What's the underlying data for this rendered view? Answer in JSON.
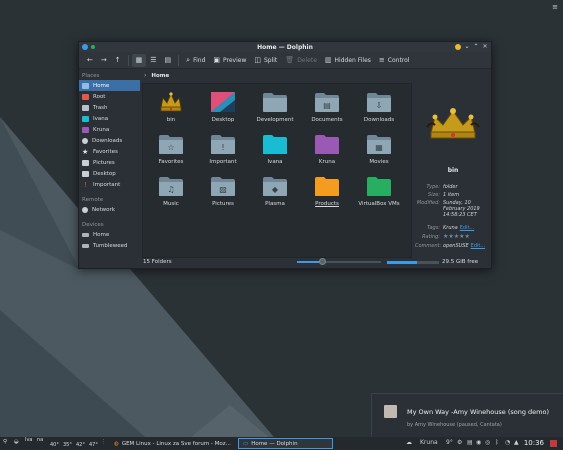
{
  "window": {
    "title": "Home — Dolphin"
  },
  "toolbar": {
    "find": "Find",
    "preview": "Preview",
    "split": "Split",
    "delete": "Delete",
    "hidden_files": "Hidden Files",
    "control": "Control"
  },
  "breadcrumb": "Home",
  "sidebar": {
    "places_heading": "Places",
    "places": [
      "Home",
      "Root",
      "Trash",
      "Ivana",
      "Kruna",
      "Downloads",
      "Favorites",
      "Pictures",
      "Desktop",
      "Important"
    ],
    "remote_heading": "Remote",
    "remote": [
      "Network"
    ],
    "devices_heading": "Devices",
    "devices": [
      "Home",
      "Tumbleweed"
    ]
  },
  "files": [
    {
      "name": "bin",
      "icon": "crown-icon"
    },
    {
      "name": "Desktop",
      "icon": "desktop-folder-icon"
    },
    {
      "name": "Development",
      "icon": "folder-icon"
    },
    {
      "name": "Documents",
      "icon": "documents-folder-icon"
    },
    {
      "name": "Downloads",
      "icon": "downloads-folder-icon"
    },
    {
      "name": "Favorites",
      "icon": "star-folder-icon"
    },
    {
      "name": "Important",
      "icon": "important-folder-icon"
    },
    {
      "name": "Ivana",
      "icon": "cyan-folder-icon"
    },
    {
      "name": "Kruna",
      "icon": "purple-folder-icon"
    },
    {
      "name": "Movies",
      "icon": "movies-folder-icon"
    },
    {
      "name": "Music",
      "icon": "music-folder-icon"
    },
    {
      "name": "Pictures",
      "icon": "pictures-folder-icon"
    },
    {
      "name": "Plasma",
      "icon": "plasma-folder-icon"
    },
    {
      "name": "Products",
      "icon": "orange-folder-icon"
    },
    {
      "name": "VirtualBox VMs",
      "icon": "green-folder-icon"
    }
  ],
  "info": {
    "name": "bin",
    "type_label": "Type:",
    "type": "folder",
    "size_label": "Size:",
    "size": "1 item",
    "modified_label": "Modified:",
    "modified": [
      "Sunday, 10",
      "February 2019",
      "14:58:23 CET"
    ],
    "tags_label": "Tags:",
    "tags": "Kruna",
    "tags_edit": "Edit...",
    "rating_label": "Rating:",
    "rating": 5,
    "rating_stars": "★★★★★",
    "comment_label": "Comment:",
    "comment": "openSUSE",
    "comment_edit": "Edit..."
  },
  "status": {
    "count": "15 Folders",
    "free": "29.5 GiB free",
    "zoom": 0.3,
    "used": 0.58
  },
  "notification": {
    "title": "My Own Way -Amy Winehouse (song demo)",
    "subtitle": "by Amy Winehouse (paused, Cantata)"
  },
  "taskbar": {
    "lang_a": "Iva",
    "lang_b": "na",
    "temps": [
      "40°",
      "35°",
      "42°",
      "47°"
    ],
    "tasks": [
      "GEM Linux - Linux za Sve forum - Moz...",
      "Home — Dolphin"
    ],
    "tray_name": "Kruna",
    "weather": "9°",
    "clock": "10:36"
  },
  "colors": {
    "accent": "#3d9ae8",
    "selection": "#3c6fa5",
    "folder": "#8fa6b5",
    "orange": "#f39c1f",
    "green": "#27ae60",
    "purple": "#9b59b6",
    "cyan": "#1abcd4"
  }
}
